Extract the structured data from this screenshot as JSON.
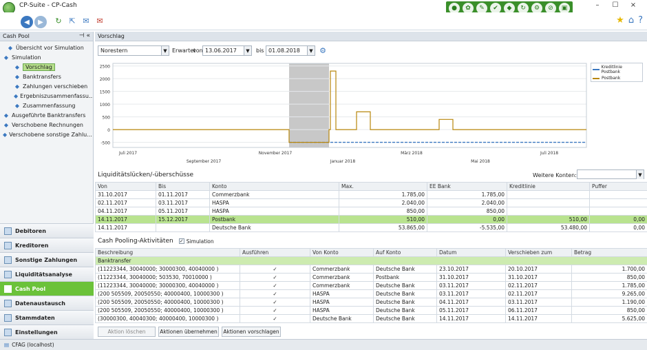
{
  "window": {
    "title": "CP-Suite - CP-Cash",
    "minimize": "–",
    "maximize": "☐",
    "close": "×"
  },
  "left": {
    "header": "Cash Pool",
    "tree": [
      {
        "label": "Übersicht vor Simulation",
        "icon": "eye-icon"
      },
      {
        "label": "Simulation",
        "icon": "grid-icon"
      },
      {
        "label": "Vorschlag",
        "icon": "document-icon",
        "selected": true
      },
      {
        "label": "Banktransfers",
        "icon": "transfer-icon"
      },
      {
        "label": "Zahlungen verschieben",
        "icon": "move-icon"
      },
      {
        "label": "Ergebniszusammenfassu...",
        "icon": "result-icon"
      },
      {
        "label": "Zusammenfassung",
        "icon": "sigma-icon"
      },
      {
        "label": "Ausgeführte Banktransfers",
        "icon": "transfer-icon"
      },
      {
        "label": "Verschobene Rechnungen",
        "icon": "invoice-icon"
      },
      {
        "label": "Verschobene sonstige Zahlu...",
        "icon": "payment-icon"
      }
    ],
    "nav": [
      "Debitoren",
      "Kreditoren",
      "Sonstige Zahlungen",
      "Liquiditätsanalyse",
      "Cash Pool",
      "Datenaustausch",
      "Stammdaten",
      "Einstellungen"
    ],
    "active_nav": "Cash Pool"
  },
  "main": {
    "header": "Vorschlag",
    "filters": {
      "company": "Norestern",
      "erwartet_label": "Erwartet",
      "von_label": "von",
      "von": "13.06.2017",
      "bis_label": "bis",
      "bis": "01.08.2018"
    }
  },
  "chart_data": {
    "type": "line",
    "y_ticks": [
      2500,
      2000,
      1500,
      1000,
      500,
      0,
      -500
    ],
    "x_labels_top": [
      "Juli 2017",
      "November 2017",
      "März 2018",
      "Juli 2018"
    ],
    "x_labels_bottom": [
      "September 2017",
      "Januar 2018",
      "Mai 2018"
    ],
    "series": [
      {
        "name": "Kreditlinie Postbank",
        "color": "#3b78c0",
        "style": "dashed",
        "values": [
          -500,
          -500
        ]
      },
      {
        "name": "Postbank",
        "color": "#b8860b",
        "style": "step",
        "values": [
          0,
          0,
          -500,
          0,
          2300,
          0,
          700,
          0,
          0,
          0,
          400,
          0,
          0,
          0
        ]
      }
    ],
    "ylim": [
      -700,
      2600
    ],
    "grid": true,
    "legend": "top-right"
  },
  "liq": {
    "title": "Liquiditätslücken/-überschüsse",
    "weitere": "Weitere Konten:",
    "headers": [
      "Von",
      "Bis",
      "Konto",
      "Max.",
      "EE Bank",
      "Kreditlinie",
      "Puffer"
    ],
    "rows": [
      [
        "31.10.2017",
        "01.11.2017",
        "Commerzbank",
        "1.785,00",
        "1.785,00",
        "",
        ""
      ],
      [
        "02.11.2017",
        "03.11.2017",
        "HASPA",
        "2.040,00",
        "2.040,00",
        "",
        ""
      ],
      [
        "04.11.2017",
        "05.11.2017",
        "HASPA",
        "850,00",
        "850,00",
        "",
        ""
      ],
      [
        "14.11.2017",
        "15.12.2017",
        "Postbank",
        "510,00",
        "0,00",
        "510,00",
        "0,00"
      ],
      [
        "14.11.2017",
        "",
        "Deutsche Bank",
        "53.865,00",
        "-5.535,00",
        "53.480,00",
        "0,00"
      ]
    ]
  },
  "act": {
    "title": "Cash Pooling-Aktivitäten",
    "sim_label": "Simulation",
    "headers": [
      "Beschreibung",
      "Ausführen",
      "Von Konto",
      "Auf Konto",
      "Datum",
      "Verschieben zum",
      "Betrag"
    ],
    "group": "Banktransfer",
    "rows": [
      [
        "(11223344, 30040000; 30000300, 40040000 )",
        "✓",
        "Commerzbank",
        "Deutsche Bank",
        "23.10.2017",
        "20.10.2017",
        "1.700,00"
      ],
      [
        "(11223344, 30040000; 503530, 70010000 )",
        "✓",
        "Commerzbank",
        "Postbank",
        "31.10.2017",
        "31.10.2017",
        "850,00"
      ],
      [
        "(11223344, 30040000; 30000300, 40040000 )",
        "✓",
        "Commerzbank",
        "Deutsche Bank",
        "03.11.2017",
        "02.11.2017",
        "1.785,00"
      ],
      [
        "(200 505509, 20050550; 40000400, 10000300 )",
        "✓",
        "HASPA",
        "Deutsche Bank",
        "03.11.2017",
        "02.11.2017",
        "9.265,00"
      ],
      [
        "(200 505509, 20050550; 40000400, 10000300 )",
        "✓",
        "HASPA",
        "Deutsche Bank",
        "04.11.2017",
        "03.11.2017",
        "1.190,00"
      ],
      [
        "(200 505509, 20050550; 40000400, 10000300 )",
        "✓",
        "HASPA",
        "Deutsche Bank",
        "05.11.2017",
        "06.11.2017",
        "850,00"
      ],
      [
        "(30000300, 40040300; 40000400, 10000300 )",
        "✓",
        "Deutsche Bank",
        "Deutsche Bank",
        "14.11.2017",
        "14.11.2017",
        "5.625,00"
      ]
    ],
    "buttons": [
      "Aktion löschen",
      "Aktionen übernehmen",
      "Aktionen vorschlagen"
    ]
  },
  "status": {
    "text": "CFAG (localhost)"
  }
}
